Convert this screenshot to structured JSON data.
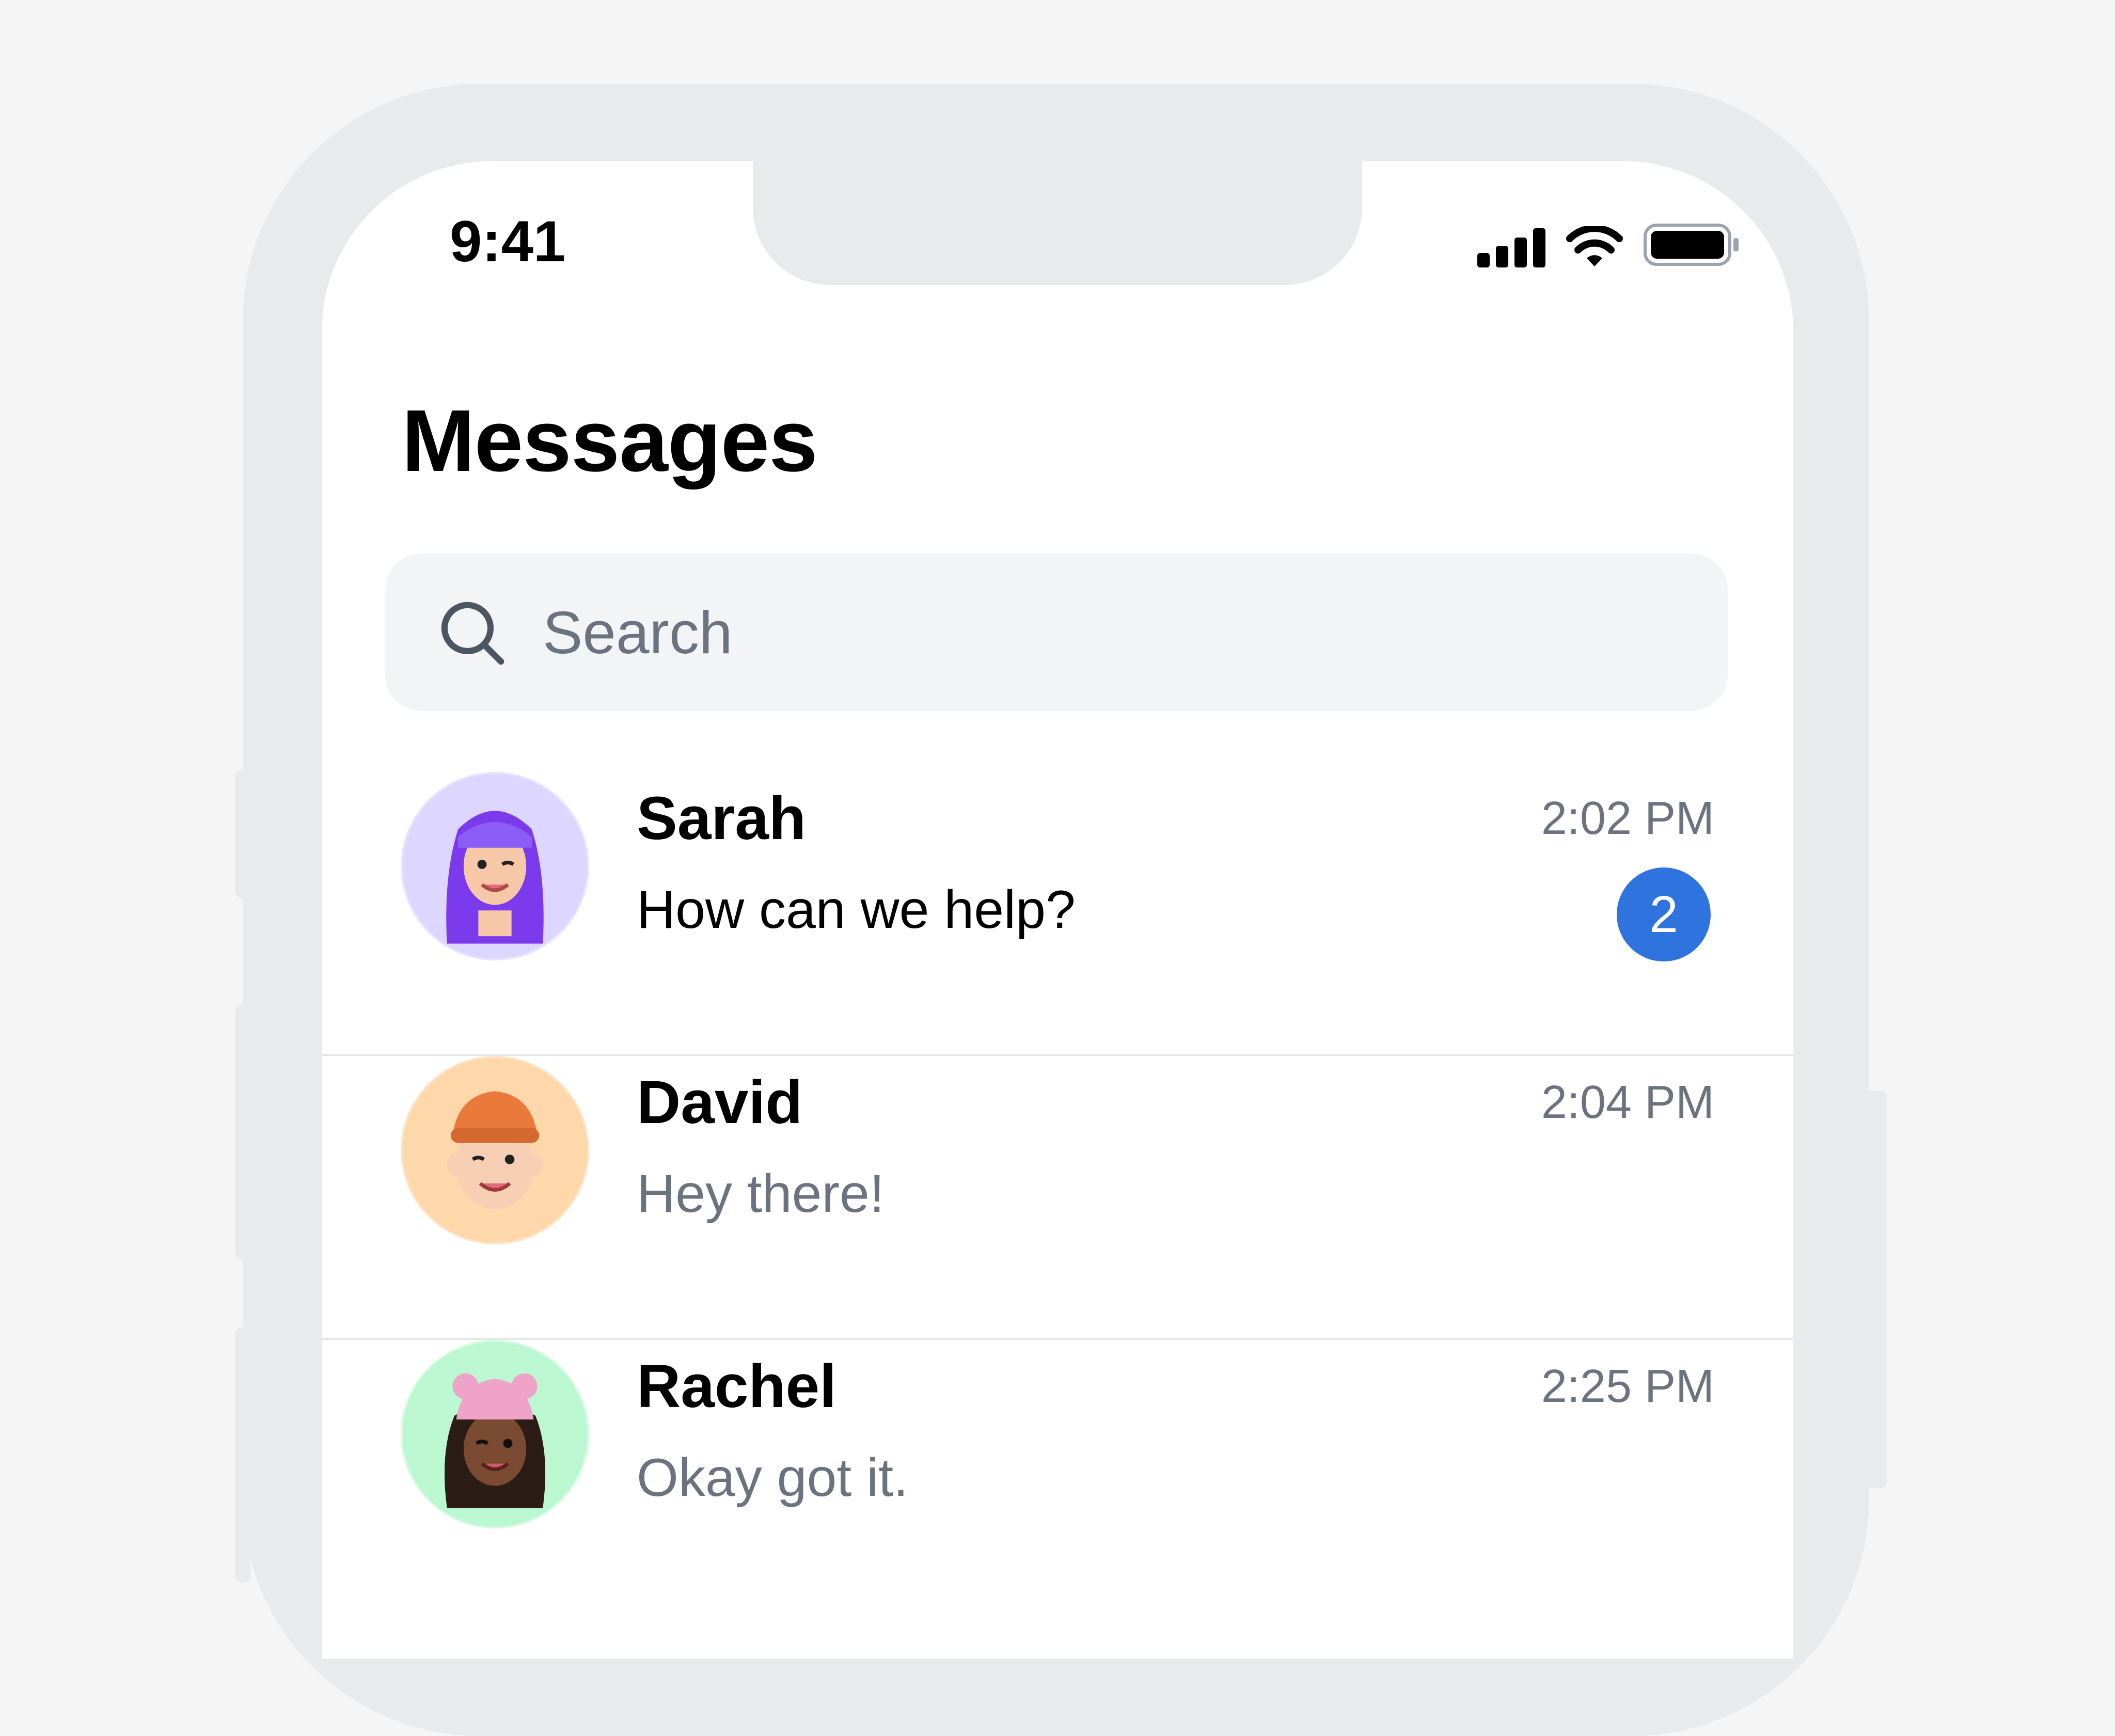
{
  "status_bar": {
    "time": "9:41",
    "icons": [
      "cellular-signal-icon",
      "wifi-icon",
      "battery-icon"
    ]
  },
  "header": {
    "title": "Messages"
  },
  "search": {
    "placeholder": "Search",
    "icon": "search-icon"
  },
  "conversations": [
    {
      "name": "Sarah",
      "message": "How can we help?",
      "time": "2:02 PM",
      "unread_count": "2",
      "unread": true,
      "avatar": {
        "name": "memoji-purple-hair",
        "bg": "#ddd6fe"
      }
    },
    {
      "name": "David",
      "message": "Hey there!",
      "time": "2:04 PM",
      "unread": false,
      "avatar": {
        "name": "memoji-orange-beanie",
        "bg": "#fed7aa"
      }
    },
    {
      "name": "Rachel",
      "message": "Okay got it.",
      "time": "2:25 PM",
      "unread": false,
      "avatar": {
        "name": "memoji-pink-hat",
        "bg": "#bbf7d0"
      }
    }
  ],
  "colors": {
    "accent": "#2f74de",
    "muted_text": "#6b7280",
    "search_bg": "#f3f4f6",
    "frame": "#e9eaeb"
  }
}
